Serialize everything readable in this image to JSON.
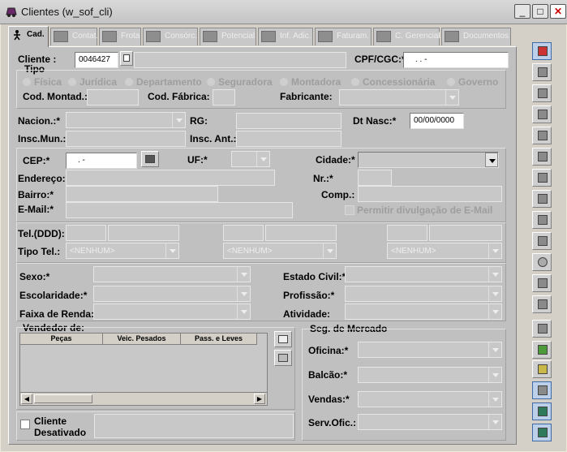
{
  "window": {
    "title": "Clientes (w_sof_cli)",
    "minimize": "_",
    "maximize": "□",
    "close": "✕"
  },
  "tabs": [
    "Cad.",
    "Contat.",
    "Frota",
    "Consórc.",
    "Potencial",
    "Inf. Adic.",
    "Faturam.",
    "C. Gerencial",
    "Documentos"
  ],
  "labels": {
    "cliente": "Cliente :",
    "tipo": "Tipo",
    "cpf": "CPF/CGC:*",
    "cod_montad": "Cod. Montad.:",
    "cod_fabrica": "Cod. Fábrica:",
    "fabricante": "Fabricante:",
    "nacion": "Nacion.:*",
    "rg": "RG:",
    "dt_nasc": "Dt Nasc:*",
    "insc_mun": "Insc.Mun.:",
    "insc_ant": "Insc. Ant.:",
    "cep": "CEP:*",
    "uf": "UF:*",
    "cidade": "Cidade:*",
    "endereco": "Endereço:*",
    "nr": "Nr.:*",
    "bairro": "Bairro:*",
    "comp": "Comp.:",
    "email": "E-Mail:*",
    "permitir": "Permitir divulgação de E-Mail",
    "tel": "Tel.(DDD):",
    "tipo_tel": "Tipo Tel.:",
    "sexo": "Sexo:*",
    "estado_civil": "Estado Civil:*",
    "escolaridade": "Escolaridade:*",
    "profissao": "Profissão:*",
    "faixa_renda": "Faixa de Renda:",
    "atividade": "Atividade:",
    "vendedor_de": "Vendedor de:",
    "seg_mercado": "Seg. de Mercado",
    "oficina": "Oficina:*",
    "balcao": "Balcão:*",
    "vendas": "Vendas:*",
    "serv_ofic": "Serv.Ofic.:",
    "cliente_desativado_1": "Cliente",
    "cliente_desativado_2": "Desativado"
  },
  "tipo_options": [
    "Física",
    "Jurídica",
    "Departamento",
    "Seguradora",
    "Montadora",
    "Concessionária",
    "Governo"
  ],
  "values": {
    "cliente_code": "0046427",
    "cpf": ". . -",
    "dt_nasc": "00/00/0000",
    "cep": ". -"
  },
  "tipo_tel_options": [
    "<NENHUM>",
    "<NENHUM>",
    "<NENHUM>"
  ],
  "vendedor_columns": [
    "Peças",
    "Veic. Pesados",
    "Pass. e Leves"
  ],
  "toolbar_icons": [
    "new-record-icon",
    "list-icon",
    "edit-icon",
    "print-icon",
    "eraser-icon",
    "search-doc-icon",
    "money-bag-icon",
    "car-icon",
    "document-icon",
    "hand-icon",
    "stop-icon",
    "copy-icon",
    "printer-icon",
    "group-icon",
    "report-green-icon",
    "report-yellow-icon",
    "windows-icon",
    "export-icon",
    "exit-icon"
  ]
}
